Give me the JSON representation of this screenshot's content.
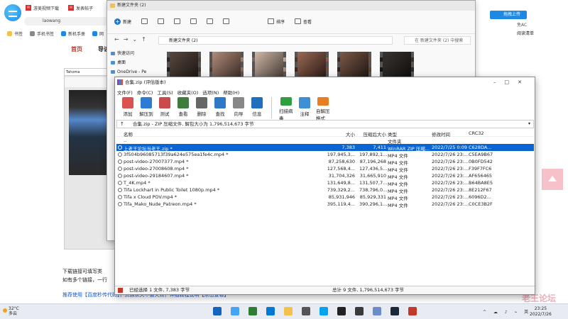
{
  "browser": {
    "tabs": [
      "游美视频下载",
      "发表帖子"
    ],
    "address": "laowang",
    "bookmarks": [
      "书签",
      "手机书签",
      "新机手册",
      "网"
    ],
    "nav": [
      "首页",
      "导读"
    ],
    "side_editor_font": "Tahoma",
    "text_line1": "下载链接可填写类",
    "text_line2": "如有多个链接，一行",
    "link_text": "推荐使用【百度秒传代码】，资源永久不会失效，详细教程说明【点击查看】",
    "right_bookmarks": "阅读清单",
    "right_text": "免AC",
    "upload_btn": "拖拽上传",
    "watermark": "老王论坛"
  },
  "explorer": {
    "title": "新建文件夹 (2)",
    "commands": [
      "新建",
      "排序",
      "查看"
    ],
    "path": "新建文件夹 (2)",
    "search_placeholder": "在 新建文件夹 (2) 中搜索",
    "nav_items": [
      "快速访问",
      "桌面",
      "OneDrive - Pe"
    ]
  },
  "rar": {
    "title": "合集.zip (评估版本)",
    "menu": [
      "文件(F)",
      "命令(C)",
      "工具(S)",
      "收藏夹(O)",
      "选项(N)",
      "帮助(H)"
    ],
    "tools": [
      "添加",
      "解压到",
      "测试",
      "查看",
      "删除",
      "查找",
      "向导",
      "信息",
      "扫描病毒",
      "注释",
      "自解压格式"
    ],
    "tool_colors": [
      "#d9534f",
      "#2e7bd6",
      "#c94b4b",
      "#3f7d3f",
      "#666666",
      "#2e78c8",
      "#888888",
      "#1f6fbf",
      "#2e9e3e",
      "#3f8fd6",
      "#e67e22"
    ],
    "path_text": "合集.zip - ZIP 压缩文件, 解包大小为 1,796,514,673 字节",
    "columns": {
      "name": "名称",
      "size": "大小",
      "packed": "压缩后大小",
      "type": "类型",
      "modified": "修改时间",
      "crc": "CRC32"
    },
    "rows": [
      {
        "name": "..",
        "size": "",
        "packed": "",
        "type": "文件夹",
        "modified": "",
        "crc": ""
      },
      {
        "name": "上老王论坛当老王.zip *",
        "size": "7,383",
        "packed": "7,411",
        "type": "WinRAR ZIP 压缩...",
        "modified": "2022/7/25 0:09",
        "crc": "C628DA..."
      },
      {
        "name": "3f504b96085713f39a624e575ea1fe4c.mp4 *",
        "size": "197,945,3...",
        "packed": "197,892,1...",
        "type": "MP4 文件",
        "modified": "2022/7/26 23:...",
        "crc": "C5EA9B67"
      },
      {
        "name": "post-video-27007377.mp4 *",
        "size": "87,258,630",
        "packed": "87,196,268",
        "type": "MP4 文件",
        "modified": "2022/7/26 23:...",
        "crc": "0B0FD542"
      },
      {
        "name": "post-video-27008608.mp4 *",
        "size": "127,568,4...",
        "packed": "127,436,5...",
        "type": "MP4 文件",
        "modified": "2022/7/26 23:...",
        "crc": "F39F7FC6"
      },
      {
        "name": "post-video-29184607.mp4 *",
        "size": "31,704,326",
        "packed": "31,665,910",
        "type": "MP4 文件",
        "modified": "2022/7/26 23:...",
        "crc": "AF656465"
      },
      {
        "name": "T_4K.mp4 *",
        "size": "131,649,8...",
        "packed": "131,507,7...",
        "type": "MP4 文件",
        "modified": "2022/7/26 23:...",
        "crc": "B64BA8E5"
      },
      {
        "name": "Tifa Lockhart in Public Toilet 1080p.mp4 *",
        "size": "739,329,2...",
        "packed": "738,796,0...",
        "type": "MP4 文件",
        "modified": "2022/7/26 23:...",
        "crc": "8E212F67"
      },
      {
        "name": "Tifa x Cloud POV.mp4 *",
        "size": "85,931,946",
        "packed": "85,929,331",
        "type": "MP4 文件",
        "modified": "2022/7/26 23:...",
        "crc": "6096D2..."
      },
      {
        "name": "Tifa_Mako_Nude_Patreon.mp4 *",
        "size": "395,119,4...",
        "packed": "390,296,1...",
        "type": "MP4 文件",
        "modified": "2022/7/26 23:...",
        "crc": "C0CE3B2F"
      }
    ],
    "status_left": "已经选择 1 文件, 7,383 字节",
    "status_right": "总计 9 文件, 1,796,514,673 字节"
  },
  "taskbar": {
    "temp": "32°C",
    "weather": "多云",
    "time": "23:25",
    "date": "2022/7/26",
    "app_colors": [
      "#1565c0",
      "#42a5f5",
      "#2e7d32",
      "#0078d4",
      "#f2c04d",
      "#555555",
      "#00a4ef",
      "#222222",
      "#3a3a3a",
      "#6b8cc8",
      "#1b2838",
      "#c0392b"
    ]
  }
}
